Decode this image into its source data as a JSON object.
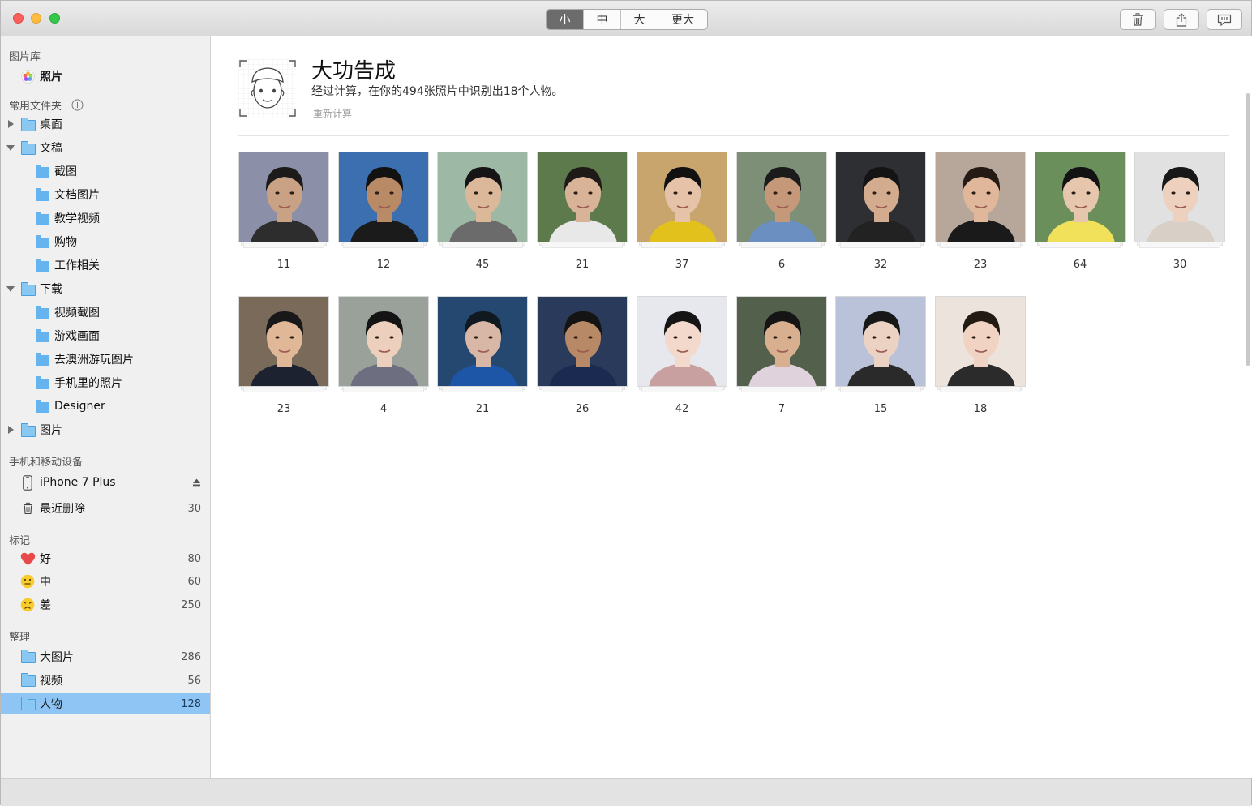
{
  "toolbar": {
    "size_options": [
      "小",
      "中",
      "大",
      "更大"
    ],
    "selected_size": "小",
    "trash_icon": "trash-icon",
    "share_icon": "share-icon",
    "chat_icon": "chat-bubble-icon"
  },
  "sidebar": {
    "library_header": "图片库",
    "photos_label": "照片",
    "favorites_header": "常用文件夹",
    "folders": [
      {
        "label": "桌面",
        "level": 0,
        "disclosure": "collapsed"
      },
      {
        "label": "文稿",
        "level": 0,
        "disclosure": "expanded"
      },
      {
        "label": "截图",
        "level": 1
      },
      {
        "label": "文档图片",
        "level": 1
      },
      {
        "label": "教学视频",
        "level": 1
      },
      {
        "label": "购物",
        "level": 1
      },
      {
        "label": "工作相关",
        "level": 1
      },
      {
        "label": "下载",
        "level": 0,
        "disclosure": "expanded"
      },
      {
        "label": "视频截图",
        "level": 1
      },
      {
        "label": "游戏画面",
        "level": 1
      },
      {
        "label": "去澳洲游玩图片",
        "level": 1
      },
      {
        "label": "手机里的照片",
        "level": 1
      },
      {
        "label": "Designer",
        "level": 1
      },
      {
        "label": "图片",
        "level": 0,
        "disclosure": "collapsed"
      }
    ],
    "devices_header": "手机和移动设备",
    "device_name": "iPhone 7 Plus",
    "recently_deleted_label": "最近删除",
    "recently_deleted_count": "30",
    "tags_header": "标记",
    "tags": [
      {
        "label": "好",
        "count": "80",
        "icon": "heart-icon"
      },
      {
        "label": "中",
        "count": "60",
        "icon": "neutral-face-icon"
      },
      {
        "label": "差",
        "count": "250",
        "icon": "sad-face-icon"
      }
    ],
    "organize_header": "整理",
    "organize": [
      {
        "label": "大图片",
        "count": "286"
      },
      {
        "label": "视频",
        "count": "56"
      },
      {
        "label": "人物",
        "count": "128",
        "selected": true
      }
    ]
  },
  "main": {
    "title": "大功告成",
    "subtitle": "经过计算，在你的494张照片中识别出18个人物。",
    "recalc_link": "重新计算",
    "people": [
      {
        "count": "11",
        "bg": "#8b8fa8",
        "skin": "#c9a184",
        "hair": "#1d1b1a",
        "shirt": "#2d2d2d"
      },
      {
        "count": "12",
        "bg": "#3c6fb0",
        "skin": "#b98a66",
        "hair": "#121212",
        "shirt": "#1b1b1b"
      },
      {
        "count": "45",
        "bg": "#9db8a4",
        "skin": "#dcb89a",
        "hair": "#161414",
        "shirt": "#6b6b6b"
      },
      {
        "count": "21",
        "bg": "#5d7a4c",
        "skin": "#d9b397",
        "hair": "#1e1a18",
        "shirt": "#e8e8e8"
      },
      {
        "count": "37",
        "bg": "#c7a56c",
        "skin": "#e6c3a8",
        "hair": "#111111",
        "shirt": "#e3c11c"
      },
      {
        "count": "6",
        "bg": "#7d8f76",
        "skin": "#c5987a",
        "hair": "#1b1b1b",
        "shirt": "#6a8fc0"
      },
      {
        "count": "32",
        "bg": "#2d2f33",
        "skin": "#d3ab8e",
        "hair": "#141414",
        "shirt": "#222222"
      },
      {
        "count": "23",
        "bg": "#b7a79a",
        "skin": "#e0b79a",
        "hair": "#251a14",
        "shirt": "#1a1a1a"
      },
      {
        "count": "64",
        "bg": "#6b8f5a",
        "skin": "#e7c6ae",
        "hair": "#131313",
        "shirt": "#f0e05a"
      },
      {
        "count": "30",
        "bg": "#e1e1e1",
        "skin": "#edd0bd",
        "hair": "#181818",
        "shirt": "#d8cfc6"
      },
      {
        "count": "23",
        "bg": "#7a6a5a",
        "skin": "#e0b898",
        "hair": "#181818",
        "shirt": "#1c2230"
      },
      {
        "count": "4",
        "bg": "#9aa09a",
        "skin": "#ecd0bd",
        "hair": "#141414",
        "shirt": "#6d6f80"
      },
      {
        "count": "21",
        "bg": "#24486f",
        "skin": "#d8b7a6",
        "hair": "#101820",
        "shirt": "#1d56a6"
      },
      {
        "count": "26",
        "bg": "#2a3a5a",
        "skin": "#b88966",
        "hair": "#141414",
        "shirt": "#1a2a50"
      },
      {
        "count": "42",
        "bg": "#e7e7ee",
        "skin": "#f2d9cb",
        "hair": "#151515",
        "shirt": "#c8a0a0"
      },
      {
        "count": "7",
        "bg": "#52604c",
        "skin": "#d8b090",
        "hair": "#151515",
        "shirt": "#e0d2dc"
      },
      {
        "count": "15",
        "bg": "#b9c2d8",
        "skin": "#ecd2c2",
        "hair": "#171717",
        "shirt": "#2a2a2a"
      },
      {
        "count": "18",
        "bg": "#ece3dc",
        "skin": "#f0d3c3",
        "hair": "#241a14",
        "shirt": "#2b2b2b"
      }
    ]
  }
}
